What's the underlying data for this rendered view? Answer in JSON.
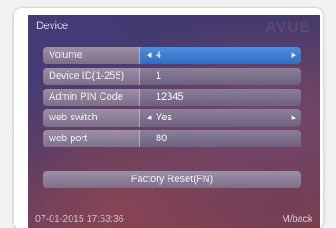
{
  "title": "Device",
  "brand": "AVUE",
  "rows": [
    {
      "label": "Volume",
      "value": "4"
    },
    {
      "label": "Device ID(1-255)",
      "value": "1"
    },
    {
      "label": "Admin PIN Code",
      "value": "12345"
    },
    {
      "label": "web switch",
      "value": "Yes"
    },
    {
      "label": "web port",
      "value": "80"
    }
  ],
  "reset_label": "Factory Reset(FN)",
  "datetime": "07-01-2015  17:53:36",
  "back_hint": "M/back",
  "colors": {
    "selected": "#3d7ed2",
    "row": "#8a7b96"
  },
  "icons": {
    "left": "arrow-left-icon",
    "right": "arrow-right-icon"
  }
}
